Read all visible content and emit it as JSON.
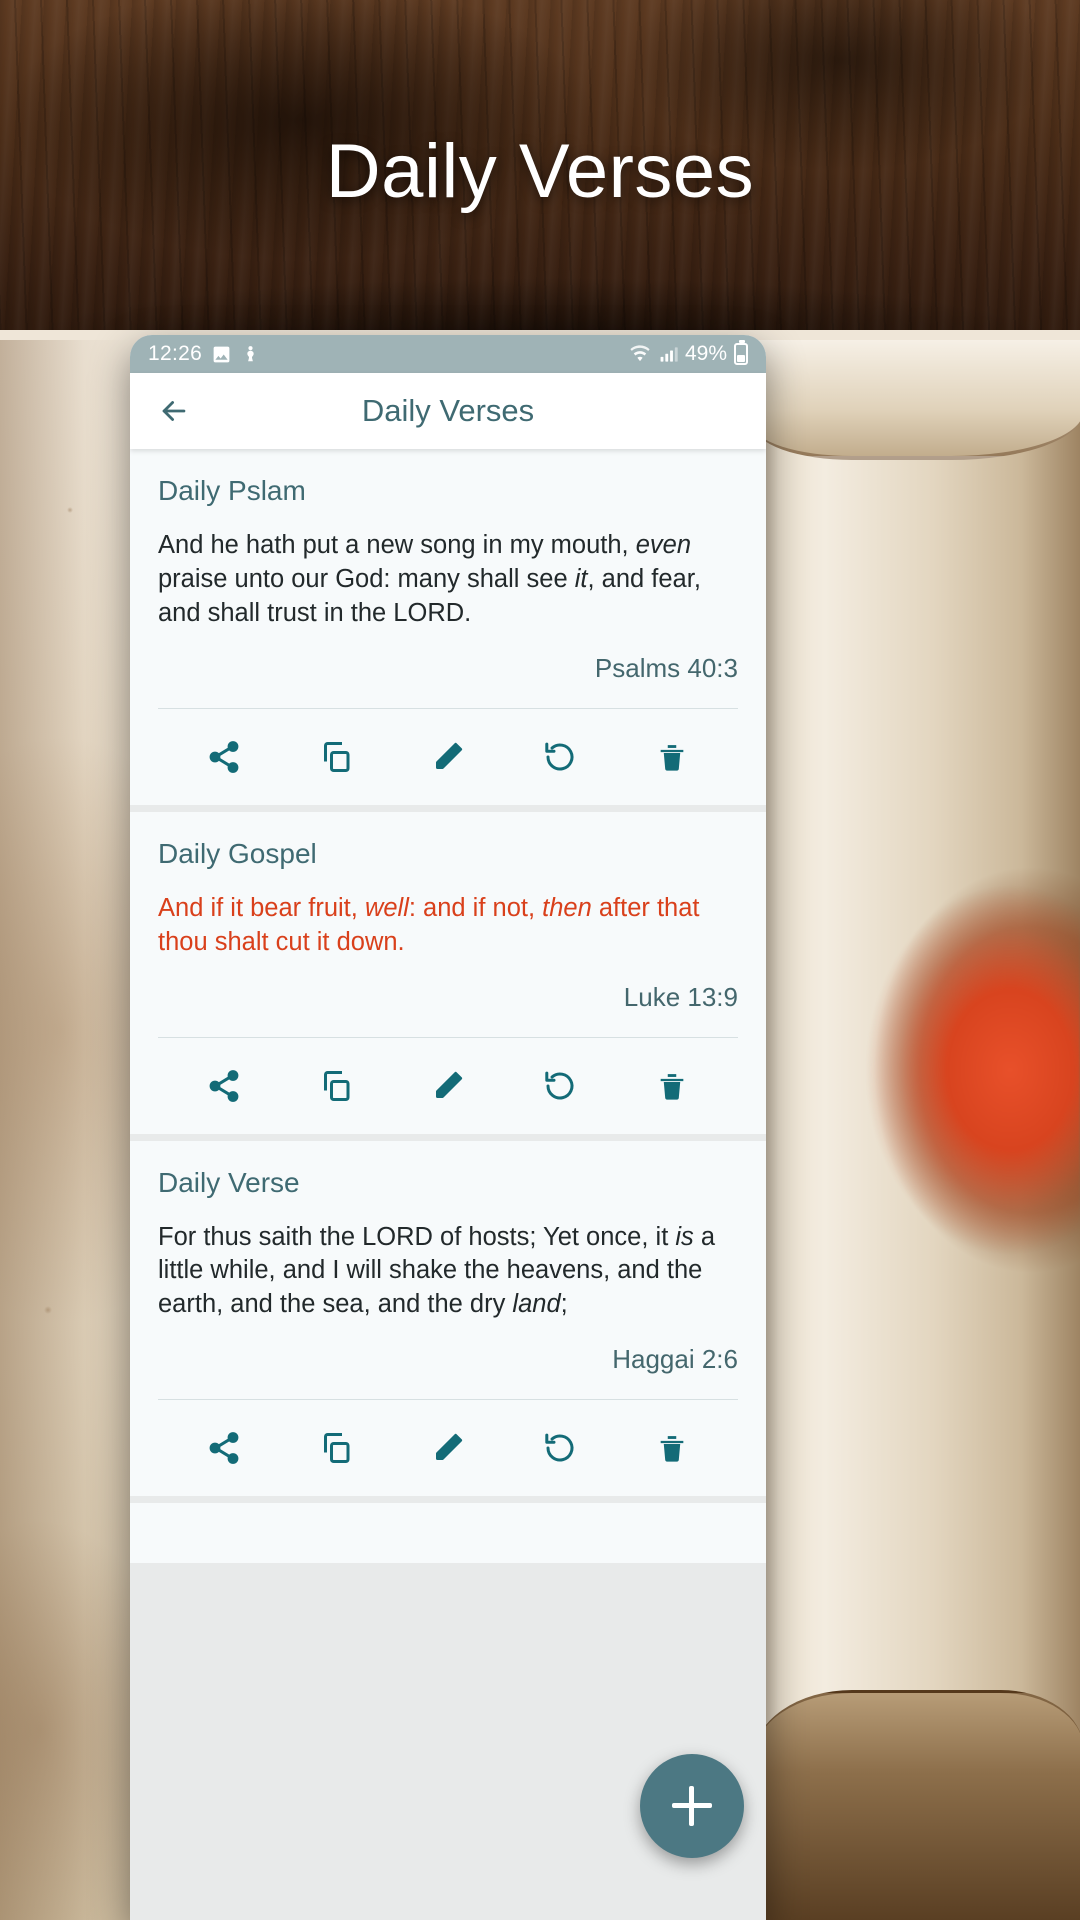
{
  "poster": {
    "title": "Daily Verses"
  },
  "status_bar": {
    "time": "12:26",
    "battery_percent": "49%",
    "icons": [
      "image-icon",
      "do-not-disturb-icon",
      "wifi-icon",
      "signal-icon",
      "battery-icon"
    ]
  },
  "app_bar": {
    "back_label": "back-arrow",
    "title": "Daily Verses"
  },
  "actions": {
    "share_label": "Share",
    "copy_label": "Copy",
    "edit_label": "Edit",
    "refresh_label": "Refresh",
    "delete_label": "Delete"
  },
  "fab": {
    "label": "+"
  },
  "colors": {
    "accent_teal": "#3f6a72",
    "icon_teal": "#136b77",
    "verse_highlight": "#d9401b",
    "fab_background": "#4c7883",
    "status_bar": "#9fb3b6",
    "card_background": "#f7fafb"
  },
  "cards": [
    {
      "title": "Daily Pslam",
      "verse_parts": [
        {
          "text": "And he hath put a new song in my mouth, ",
          "italic": false
        },
        {
          "text": "even",
          "italic": true
        },
        {
          "text": " praise unto our God: many shall see ",
          "italic": false
        },
        {
          "text": "it",
          "italic": true
        },
        {
          "text": ", and fear, and shall trust in the LORD.",
          "italic": false
        }
      ],
      "reference": "Psalms 40:3",
      "highlight": false
    },
    {
      "title": "Daily Gospel",
      "verse_parts": [
        {
          "text": "And if it bear fruit, ",
          "italic": false
        },
        {
          "text": "well",
          "italic": true
        },
        {
          "text": ": and if not, ",
          "italic": false
        },
        {
          "text": "then",
          "italic": true
        },
        {
          "text": " after that thou shalt cut it down.",
          "italic": false
        }
      ],
      "reference": "Luke 13:9",
      "highlight": true
    },
    {
      "title": "Daily Verse",
      "verse_parts": [
        {
          "text": "For thus saith the LORD of hosts; Yet once, it ",
          "italic": false
        },
        {
          "text": "is",
          "italic": true
        },
        {
          "text": " a little while, and I will shake the heavens, and the earth, and the sea, and the dry ",
          "italic": false
        },
        {
          "text": "land",
          "italic": true
        },
        {
          "text": ";",
          "italic": false
        }
      ],
      "reference": "Haggai 2:6",
      "highlight": false
    }
  ]
}
